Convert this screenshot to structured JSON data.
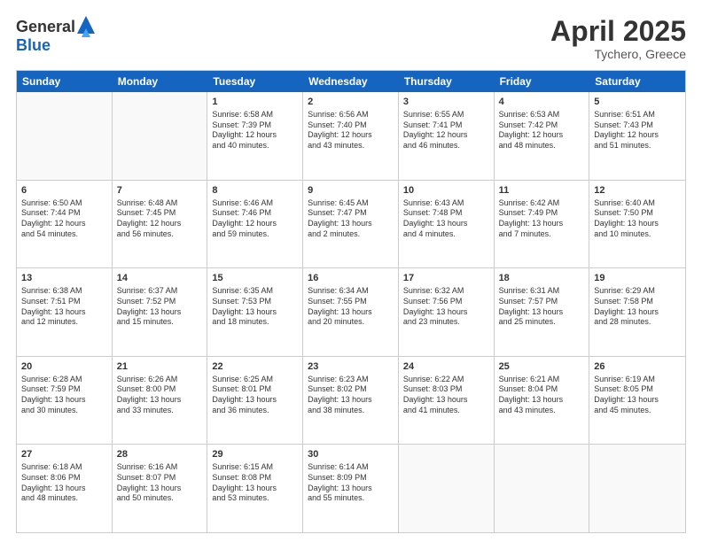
{
  "header": {
    "logo_general": "General",
    "logo_blue": "Blue",
    "title": "April 2025",
    "location": "Tychero, Greece"
  },
  "weekdays": [
    "Sunday",
    "Monday",
    "Tuesday",
    "Wednesday",
    "Thursday",
    "Friday",
    "Saturday"
  ],
  "rows": [
    [
      {
        "day": "",
        "lines": []
      },
      {
        "day": "",
        "lines": []
      },
      {
        "day": "1",
        "lines": [
          "Sunrise: 6:58 AM",
          "Sunset: 7:39 PM",
          "Daylight: 12 hours",
          "and 40 minutes."
        ]
      },
      {
        "day": "2",
        "lines": [
          "Sunrise: 6:56 AM",
          "Sunset: 7:40 PM",
          "Daylight: 12 hours",
          "and 43 minutes."
        ]
      },
      {
        "day": "3",
        "lines": [
          "Sunrise: 6:55 AM",
          "Sunset: 7:41 PM",
          "Daylight: 12 hours",
          "and 46 minutes."
        ]
      },
      {
        "day": "4",
        "lines": [
          "Sunrise: 6:53 AM",
          "Sunset: 7:42 PM",
          "Daylight: 12 hours",
          "and 48 minutes."
        ]
      },
      {
        "day": "5",
        "lines": [
          "Sunrise: 6:51 AM",
          "Sunset: 7:43 PM",
          "Daylight: 12 hours",
          "and 51 minutes."
        ]
      }
    ],
    [
      {
        "day": "6",
        "lines": [
          "Sunrise: 6:50 AM",
          "Sunset: 7:44 PM",
          "Daylight: 12 hours",
          "and 54 minutes."
        ]
      },
      {
        "day": "7",
        "lines": [
          "Sunrise: 6:48 AM",
          "Sunset: 7:45 PM",
          "Daylight: 12 hours",
          "and 56 minutes."
        ]
      },
      {
        "day": "8",
        "lines": [
          "Sunrise: 6:46 AM",
          "Sunset: 7:46 PM",
          "Daylight: 12 hours",
          "and 59 minutes."
        ]
      },
      {
        "day": "9",
        "lines": [
          "Sunrise: 6:45 AM",
          "Sunset: 7:47 PM",
          "Daylight: 13 hours",
          "and 2 minutes."
        ]
      },
      {
        "day": "10",
        "lines": [
          "Sunrise: 6:43 AM",
          "Sunset: 7:48 PM",
          "Daylight: 13 hours",
          "and 4 minutes."
        ]
      },
      {
        "day": "11",
        "lines": [
          "Sunrise: 6:42 AM",
          "Sunset: 7:49 PM",
          "Daylight: 13 hours",
          "and 7 minutes."
        ]
      },
      {
        "day": "12",
        "lines": [
          "Sunrise: 6:40 AM",
          "Sunset: 7:50 PM",
          "Daylight: 13 hours",
          "and 10 minutes."
        ]
      }
    ],
    [
      {
        "day": "13",
        "lines": [
          "Sunrise: 6:38 AM",
          "Sunset: 7:51 PM",
          "Daylight: 13 hours",
          "and 12 minutes."
        ]
      },
      {
        "day": "14",
        "lines": [
          "Sunrise: 6:37 AM",
          "Sunset: 7:52 PM",
          "Daylight: 13 hours",
          "and 15 minutes."
        ]
      },
      {
        "day": "15",
        "lines": [
          "Sunrise: 6:35 AM",
          "Sunset: 7:53 PM",
          "Daylight: 13 hours",
          "and 18 minutes."
        ]
      },
      {
        "day": "16",
        "lines": [
          "Sunrise: 6:34 AM",
          "Sunset: 7:55 PM",
          "Daylight: 13 hours",
          "and 20 minutes."
        ]
      },
      {
        "day": "17",
        "lines": [
          "Sunrise: 6:32 AM",
          "Sunset: 7:56 PM",
          "Daylight: 13 hours",
          "and 23 minutes."
        ]
      },
      {
        "day": "18",
        "lines": [
          "Sunrise: 6:31 AM",
          "Sunset: 7:57 PM",
          "Daylight: 13 hours",
          "and 25 minutes."
        ]
      },
      {
        "day": "19",
        "lines": [
          "Sunrise: 6:29 AM",
          "Sunset: 7:58 PM",
          "Daylight: 13 hours",
          "and 28 minutes."
        ]
      }
    ],
    [
      {
        "day": "20",
        "lines": [
          "Sunrise: 6:28 AM",
          "Sunset: 7:59 PM",
          "Daylight: 13 hours",
          "and 30 minutes."
        ]
      },
      {
        "day": "21",
        "lines": [
          "Sunrise: 6:26 AM",
          "Sunset: 8:00 PM",
          "Daylight: 13 hours",
          "and 33 minutes."
        ]
      },
      {
        "day": "22",
        "lines": [
          "Sunrise: 6:25 AM",
          "Sunset: 8:01 PM",
          "Daylight: 13 hours",
          "and 36 minutes."
        ]
      },
      {
        "day": "23",
        "lines": [
          "Sunrise: 6:23 AM",
          "Sunset: 8:02 PM",
          "Daylight: 13 hours",
          "and 38 minutes."
        ]
      },
      {
        "day": "24",
        "lines": [
          "Sunrise: 6:22 AM",
          "Sunset: 8:03 PM",
          "Daylight: 13 hours",
          "and 41 minutes."
        ]
      },
      {
        "day": "25",
        "lines": [
          "Sunrise: 6:21 AM",
          "Sunset: 8:04 PM",
          "Daylight: 13 hours",
          "and 43 minutes."
        ]
      },
      {
        "day": "26",
        "lines": [
          "Sunrise: 6:19 AM",
          "Sunset: 8:05 PM",
          "Daylight: 13 hours",
          "and 45 minutes."
        ]
      }
    ],
    [
      {
        "day": "27",
        "lines": [
          "Sunrise: 6:18 AM",
          "Sunset: 8:06 PM",
          "Daylight: 13 hours",
          "and 48 minutes."
        ]
      },
      {
        "day": "28",
        "lines": [
          "Sunrise: 6:16 AM",
          "Sunset: 8:07 PM",
          "Daylight: 13 hours",
          "and 50 minutes."
        ]
      },
      {
        "day": "29",
        "lines": [
          "Sunrise: 6:15 AM",
          "Sunset: 8:08 PM",
          "Daylight: 13 hours",
          "and 53 minutes."
        ]
      },
      {
        "day": "30",
        "lines": [
          "Sunrise: 6:14 AM",
          "Sunset: 8:09 PM",
          "Daylight: 13 hours",
          "and 55 minutes."
        ]
      },
      {
        "day": "",
        "lines": []
      },
      {
        "day": "",
        "lines": []
      },
      {
        "day": "",
        "lines": []
      }
    ]
  ]
}
